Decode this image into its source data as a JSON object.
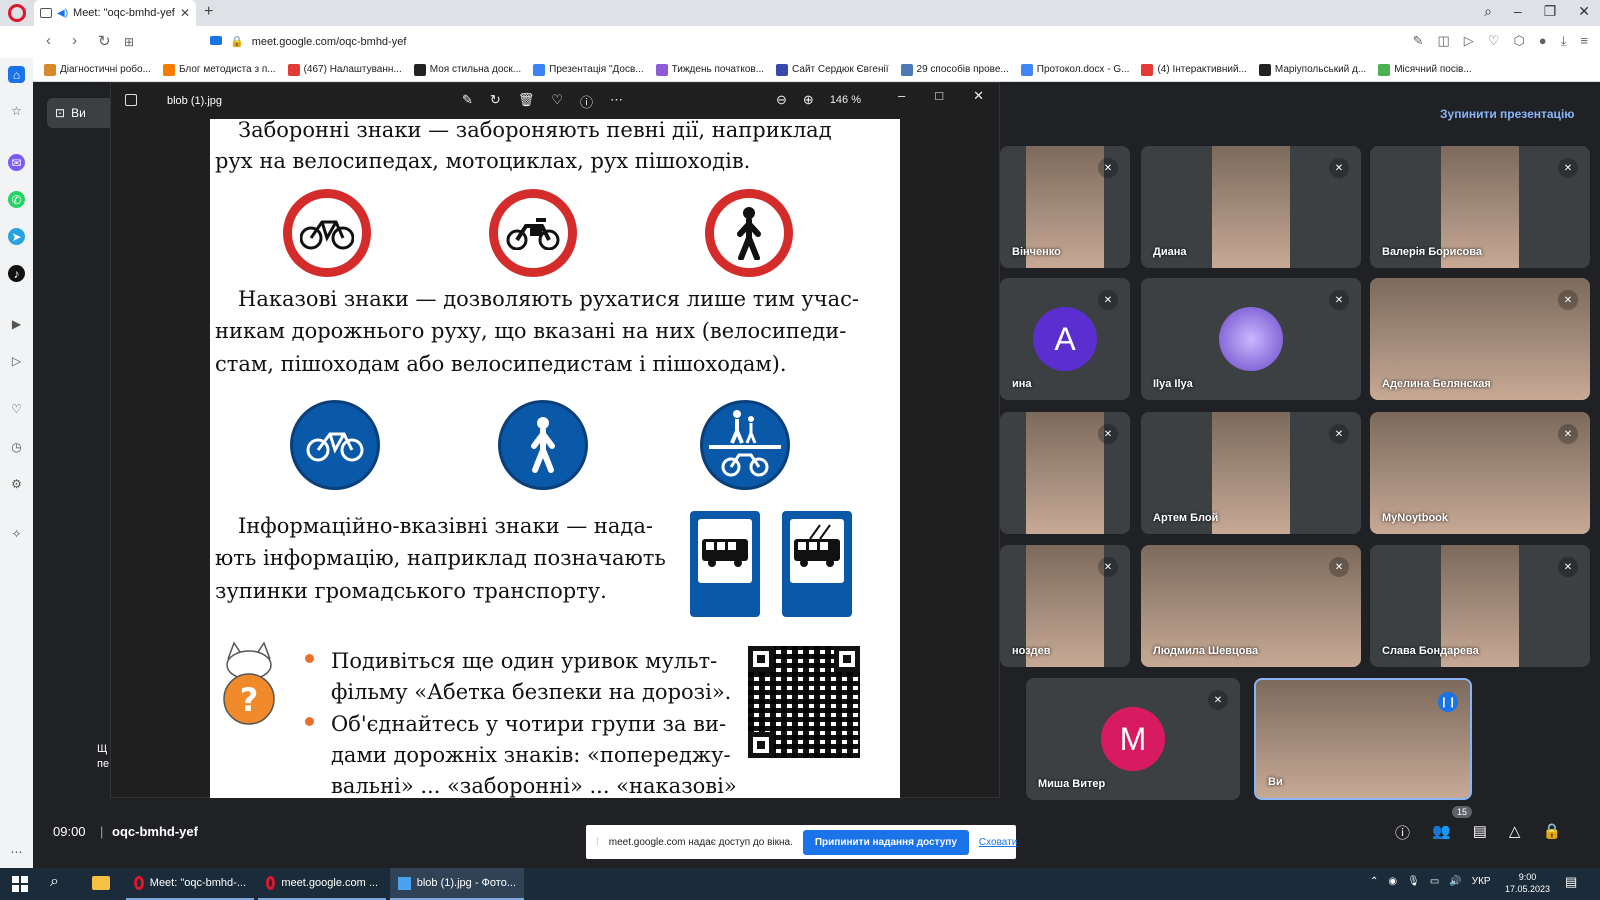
{
  "browser": {
    "tab_title": "Meet: \"oqc-bmhd-yef\"",
    "url": "meet.google.com/oqc-bmhd-yef",
    "bookmarks": [
      {
        "label": "Діагностичні робо...",
        "color": "#d88a2a"
      },
      {
        "label": "Блог методиста з п...",
        "color": "#f57c00"
      },
      {
        "label": "(467) Налаштуванн...",
        "color": "#e53935"
      },
      {
        "label": "Моя стильна доск...",
        "color": "#222222"
      },
      {
        "label": "Презентація \"Досв...",
        "color": "#3b82f6"
      },
      {
        "label": "Тиждень початков...",
        "color": "#8e5bd8"
      },
      {
        "label": "Сайт Сердюк Євгенії",
        "color": "#3949ab"
      },
      {
        "label": "29 способів прове...",
        "color": "#4a7bb7"
      },
      {
        "label": "Протокол.docx - G...",
        "color": "#4285f4"
      },
      {
        "label": "(4) Інтерактивний...",
        "color": "#e53935"
      },
      {
        "label": "Маріупольський д...",
        "color": "#222222"
      },
      {
        "label": "Місячний посів...",
        "color": "#4caf50"
      }
    ]
  },
  "viewer": {
    "filename": "blob (1).jpg",
    "zoom": "146 %"
  },
  "page": {
    "line1": "Заборонні знаки — забороняють певні дії, наприклад",
    "line2": "рух на велосипедах, мотоциклах, рух пішоходів.",
    "line3": "Наказові знаки — дозволяють рухатися лише тим учас-",
    "line4": "никам дорожнього руху, що вказані на них (велосипеди-",
    "line5": "стам, пішоходам або велосипедистам і пішоходам).",
    "line6": "Інформаційно-вказівні знаки — нада-",
    "line7": "ють інформацію, наприклад позначають",
    "line8": "зупинки громадського транспорту.",
    "bullet1a": "Подивіться ще один уривок мульт-",
    "bullet1b": "фільму «Абетка безпеки на дорозі».",
    "bullet2a": "Об'єднайтесь у чотири групи за ви-",
    "bullet2b": "дами дорожніх знаків: «попереджу-",
    "bullet2c": "вальні» ... «заборонні» ... «наказові»"
  },
  "meet": {
    "stop_presenting": "Зупинити презентацію",
    "present_label": "Ви",
    "left_caption_1": "Щ",
    "left_caption_2": "пе",
    "time": "09:00",
    "code": "oqc-bmhd-yef",
    "people_count": "15",
    "participants": [
      {
        "name": "Вінченко"
      },
      {
        "name": "Диана"
      },
      {
        "name": "Валерія Борисова"
      },
      {
        "name": "ина",
        "initial": "A",
        "color": "#5b2ecf"
      },
      {
        "name": "Ilya Ilya"
      },
      {
        "name": "Аделина Белянская"
      },
      {
        "name": ""
      },
      {
        "name": "Артем Блой"
      },
      {
        "name": "MyNoytbook"
      },
      {
        "name": "ноздев"
      },
      {
        "name": "Людмила Шевцова"
      },
      {
        "name": "Слава Бондарева"
      },
      {
        "name": "Миша Витер",
        "initial": "M",
        "color": "#d81b60"
      },
      {
        "name": "Ви"
      }
    ]
  },
  "share_bar": {
    "text": "meet.google.com надає доступ до вікна.",
    "stop": "Припинити надання доступу",
    "hide": "Сховати"
  },
  "taskbar": {
    "items": [
      "Meet: \"oqc-bmhd-...",
      "meet.google.com ...",
      "blob (1).jpg - Фото..."
    ],
    "lang": "УКР",
    "time": "9:00",
    "date": "17.05.2023"
  }
}
